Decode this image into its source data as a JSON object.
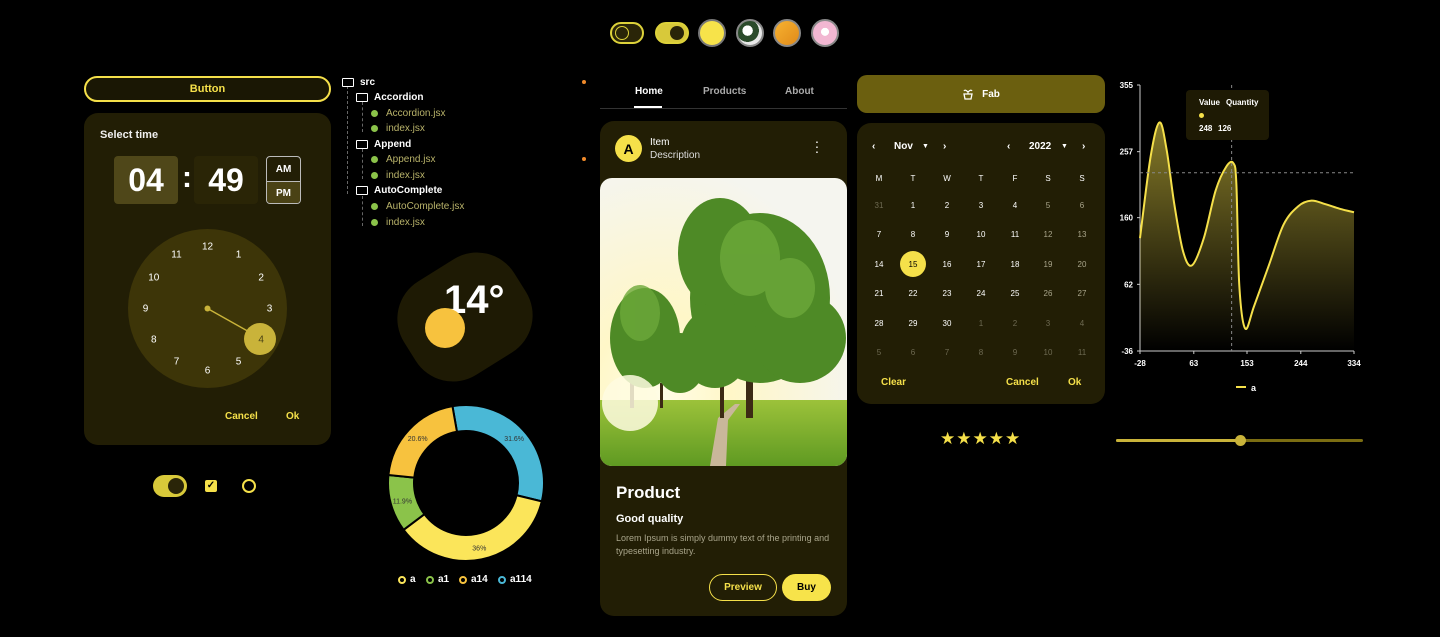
{
  "top_row": {
    "toggles": [
      {
        "name": "dark-mode"
      },
      {
        "name": "light-mode"
      }
    ],
    "swatches": [
      "#f7e34a",
      "#e8e8e8",
      "#f0a52a",
      "#f2b7d2"
    ]
  },
  "button": {
    "label": "Button"
  },
  "time_picker": {
    "title": "Select time",
    "hour": "04",
    "minute": "49",
    "am": "AM",
    "pm": "PM",
    "numbers": [
      "12",
      "1",
      "2",
      "3",
      "4",
      "5",
      "6",
      "7",
      "8",
      "9",
      "10",
      "11"
    ],
    "selected_number": "4",
    "cancel": "Cancel",
    "ok": "Ok"
  },
  "tree": {
    "root": "src",
    "folders": [
      {
        "name": "Accordion",
        "files": [
          "Accordion.jsx",
          "index.jsx"
        ]
      },
      {
        "name": "Append",
        "files": [
          "Append.jsx",
          "index.jsx"
        ]
      },
      {
        "name": "AutoComplete",
        "files": [
          "AutoComplete.jsx",
          "index.jsx"
        ]
      }
    ]
  },
  "weather": {
    "temperature": "14°"
  },
  "donut": {
    "segments": [
      {
        "label": "31.6%",
        "value": 31.6,
        "color": "#4ab8d6"
      },
      {
        "label": "36%",
        "value": 36,
        "color": "#fbe55a"
      },
      {
        "label": "11.9%",
        "value": 11.9,
        "color": "#8bc34a"
      },
      {
        "label": "20.6%",
        "value": 20.6,
        "color": "#f7c23e"
      }
    ],
    "legend": [
      {
        "name": "a",
        "color": "#fbe55a"
      },
      {
        "name": "a1",
        "color": "#8bc34a"
      },
      {
        "name": "a14",
        "color": "#f7c23e"
      },
      {
        "name": "a114",
        "color": "#4ab8d6"
      }
    ]
  },
  "tabs": [
    "Home",
    "Products",
    "About"
  ],
  "product": {
    "avatar_letter": "A",
    "item": "Item",
    "description": "Description",
    "title": "Product",
    "quality": "Good quality",
    "text": "Lorem Ipsum is simply dummy text of the printing and typesetting industry.",
    "preview": "Preview",
    "buy": "Buy"
  },
  "fab": {
    "label": "Fab",
    "icon": "potted-plant-icon"
  },
  "calendar": {
    "month": "Nov",
    "year": "2022",
    "weekdays": [
      "M",
      "T",
      "W",
      "T",
      "F",
      "S",
      "S"
    ],
    "days": [
      [
        "31",
        "1",
        "2",
        "3",
        "4",
        "5",
        "6"
      ],
      [
        "7",
        "8",
        "9",
        "10",
        "11",
        "12",
        "13"
      ],
      [
        "14",
        "15",
        "16",
        "17",
        "18",
        "19",
        "20"
      ],
      [
        "21",
        "22",
        "23",
        "24",
        "25",
        "26",
        "27"
      ],
      [
        "28",
        "29",
        "30",
        "1",
        "2",
        "3",
        "4"
      ],
      [
        "5",
        "6",
        "7",
        "8",
        "9",
        "10",
        "11"
      ]
    ],
    "selected": "15",
    "clear": "Clear",
    "cancel": "Cancel",
    "ok": "Ok"
  },
  "rating": {
    "stars": 5,
    "max": 5
  },
  "chart": {
    "tooltip_value_label": "Value",
    "tooltip_quantity_label": "Quantity",
    "tooltip_value": "248",
    "tooltip_quantity": "126"
  },
  "chart_data": {
    "type": "area",
    "xlim": [
      -28,
      334
    ],
    "ylim": [
      -36,
      355
    ],
    "x_ticks": [
      "-28",
      "63",
      "153",
      "244",
      "334"
    ],
    "y_ticks": [
      "355",
      "257",
      "160",
      "62",
      "-36"
    ],
    "series": [
      {
        "name": "a",
        "color": "#f5e04a",
        "x": [
          -28,
          -10,
          5,
          17,
          30,
          45,
          60,
          80,
          100,
          118,
          130,
          135,
          140,
          150,
          165,
          190,
          215,
          240,
          262,
          285,
          310,
          334
        ],
        "y": [
          130,
          250,
          300,
          260,
          180,
          110,
          90,
          130,
          200,
          235,
          240,
          210,
          60,
          -3,
          30,
          90,
          150,
          177,
          185,
          180,
          173,
          168
        ]
      }
    ],
    "crosshair": {
      "x": 127,
      "y": 226
    },
    "legend": "a"
  },
  "slider": {
    "value": 0.5
  }
}
